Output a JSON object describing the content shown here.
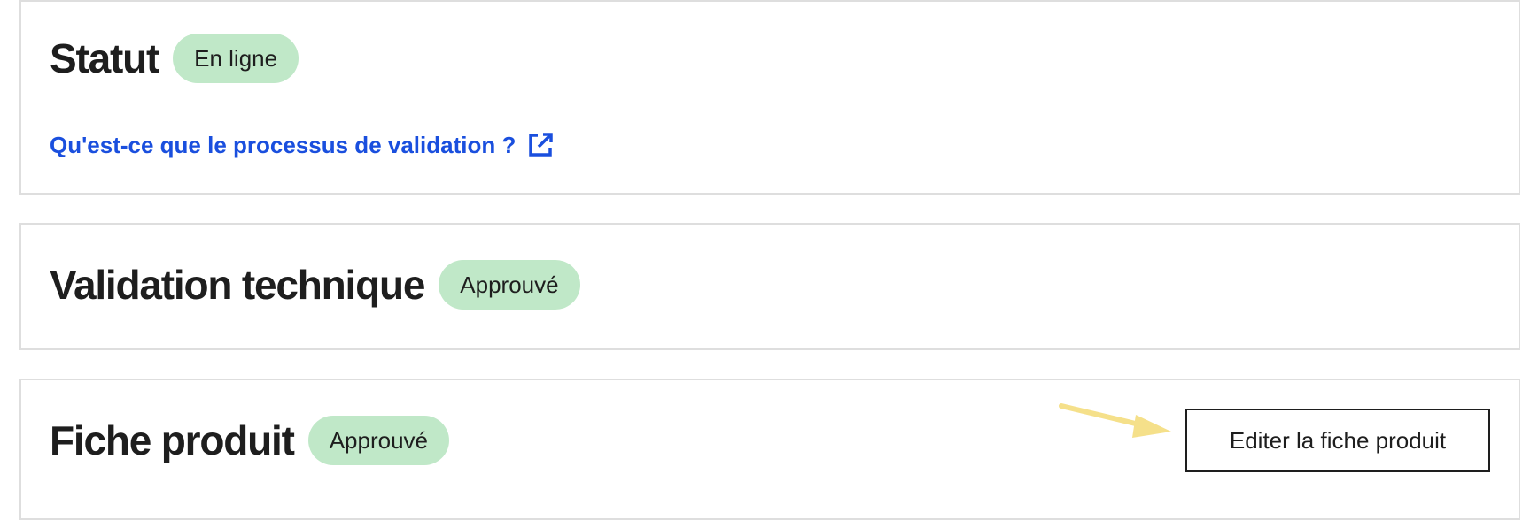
{
  "status_section": {
    "title": "Statut",
    "badge": "En ligne",
    "help_link": "Qu'est-ce que le processus de validation ?",
    "help_link_icon": "external-link-icon"
  },
  "technical_validation_section": {
    "title": "Validation technique",
    "badge": "Approuvé"
  },
  "product_sheet_section": {
    "title": "Fiche produit",
    "badge": "Approuvé",
    "edit_button_label": "Editer la fiche produit"
  },
  "annotation": {
    "icon": "arrow-annotation-icon",
    "color": "#f5e08a"
  },
  "colors": {
    "badge_background": "#c0e8c8",
    "link": "#1a4fde",
    "card_border": "#dedede",
    "text": "#1e1e1e"
  }
}
